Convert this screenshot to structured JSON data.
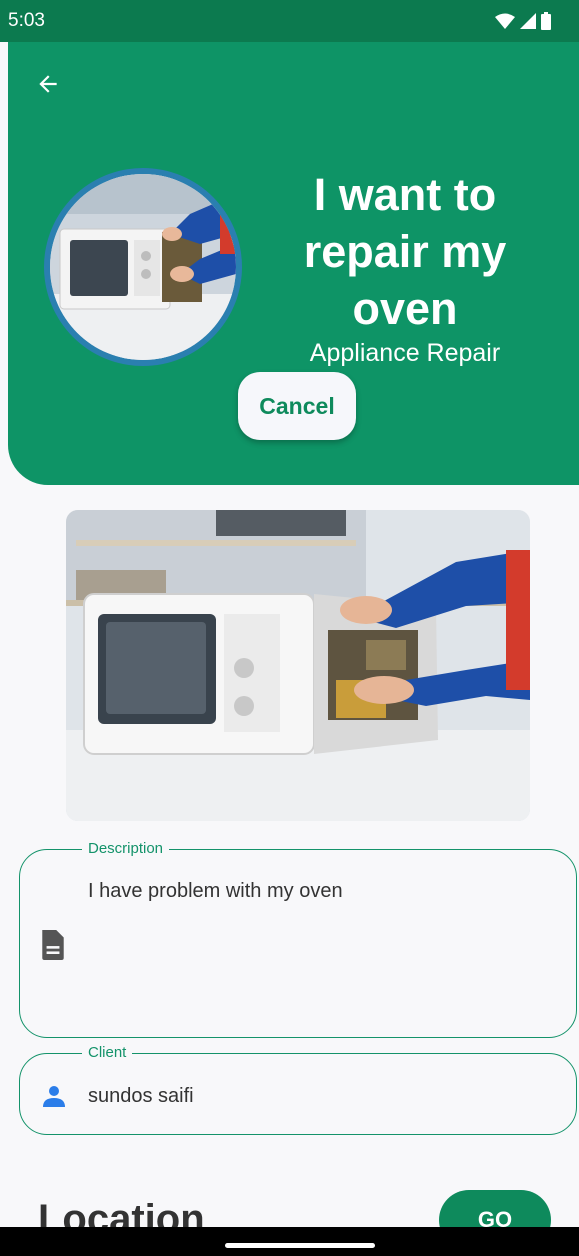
{
  "status_bar": {
    "time": "5:03"
  },
  "header": {
    "title": "I want to repair my oven",
    "category": "Appliance Repair",
    "cancel_label": "Cancel"
  },
  "description": {
    "label": "Description",
    "value": "I have problem with my oven"
  },
  "client": {
    "label": "Client",
    "value": "sundos saifi"
  },
  "location": {
    "heading": "Location",
    "go_label": "GO"
  },
  "icons": {
    "back": "arrow-back-icon",
    "description": "document-icon",
    "client": "person-icon",
    "wifi": "wifi-icon",
    "signal": "signal-icon",
    "battery": "battery-icon"
  },
  "colors": {
    "primary": "#0e9466",
    "status_bar": "#0c7a4f",
    "accent_text": "#0e8a5c",
    "person_icon": "#2b7de9",
    "background": "#f8f8fa"
  }
}
